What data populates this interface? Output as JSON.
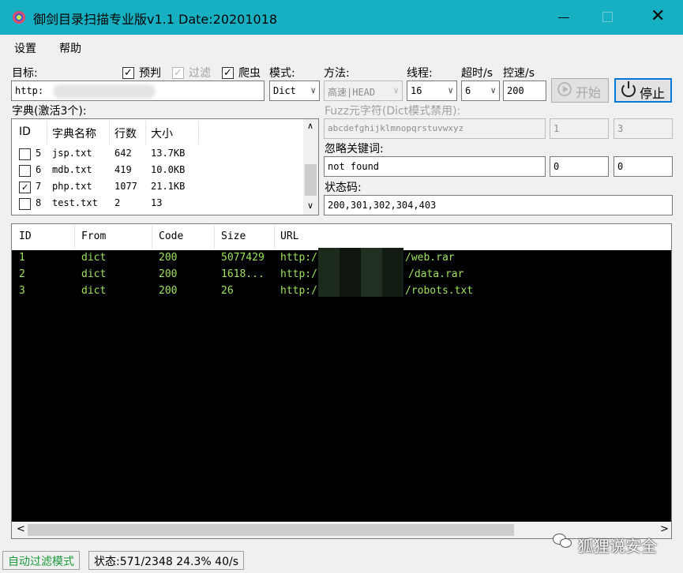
{
  "window": {
    "title": "御剑目录扫描专业版v1.1 Date:20201018",
    "controls": {
      "minimize": "—",
      "maximize": "☐",
      "close": "✕"
    }
  },
  "menu": [
    "设置",
    "帮助"
  ],
  "form": {
    "target_label": "目标:",
    "target_value": "http:",
    "options": [
      {
        "label": "预判",
        "checked": true,
        "enabled": true
      },
      {
        "label": "过滤",
        "checked": true,
        "enabled": false
      },
      {
        "label": "爬虫",
        "checked": true,
        "enabled": true
      }
    ],
    "mode_label": "模式:",
    "mode_value": "Dict",
    "method_label": "方法:",
    "method_value": "高速|HEAD",
    "threads_label": "线程:",
    "threads_value": "16",
    "timeout_label": "超时/s",
    "timeout_value": "6",
    "rate_label": "控速/s",
    "rate_value": "200",
    "start_button": "开始",
    "stop_button": "停止"
  },
  "dict": {
    "label": "字典(激活3个):",
    "columns": [
      "ID",
      "字典名称",
      "行数",
      "大小"
    ],
    "rows": [
      {
        "id": "5",
        "name": "jsp.txt",
        "lines": "642",
        "size": "13.7KB",
        "checked": false
      },
      {
        "id": "6",
        "name": "mdb.txt",
        "lines": "419",
        "size": "10.0KB",
        "checked": false
      },
      {
        "id": "7",
        "name": "php.txt",
        "lines": "1077",
        "size": "21.1KB",
        "checked": true
      },
      {
        "id": "8",
        "name": "test.txt",
        "lines": "2",
        "size": "13",
        "checked": false
      }
    ],
    "scroll_up": "∧",
    "scroll_down": "∨"
  },
  "fuzz": {
    "label": "Fuzz元字符(Dict模式禁用):",
    "chars": "abcdefghijklmnopqrstuvwxyz",
    "min": "1",
    "max": "3"
  },
  "ignore": {
    "label": "忽略关键词:",
    "keyword": "not found",
    "a": "0",
    "b": "0"
  },
  "status_codes": {
    "label": "状态码:",
    "value": "200,301,302,304,403"
  },
  "results": {
    "columns": [
      "ID",
      "From",
      "Code",
      "Size",
      "URL"
    ],
    "rows": [
      {
        "id": "1",
        "from": "dict",
        "code": "200",
        "size": "5077429",
        "url_prefix": "http://",
        "url_suffix": "/web.rar"
      },
      {
        "id": "2",
        "from": "dict",
        "code": "200",
        "size": "1618...",
        "url_prefix": "http://",
        "url_suffix": "/data.rar"
      },
      {
        "id": "3",
        "from": "dict",
        "code": "200",
        "size": "26",
        "url_prefix": "http://",
        "url_suffix": "/robots.txt"
      }
    ],
    "scroll_left": "<",
    "scroll_right": ">"
  },
  "statusbar": {
    "mode": "自动过滤模式",
    "status": "状态:571/2348 24.3% 40/s"
  },
  "watermark": "狐狸说安全",
  "colors": {
    "titlebar": "#16b0c2",
    "result_text": "#9ee35a",
    "result_bg": "#000000",
    "mode_text": "#1a9a3a"
  }
}
